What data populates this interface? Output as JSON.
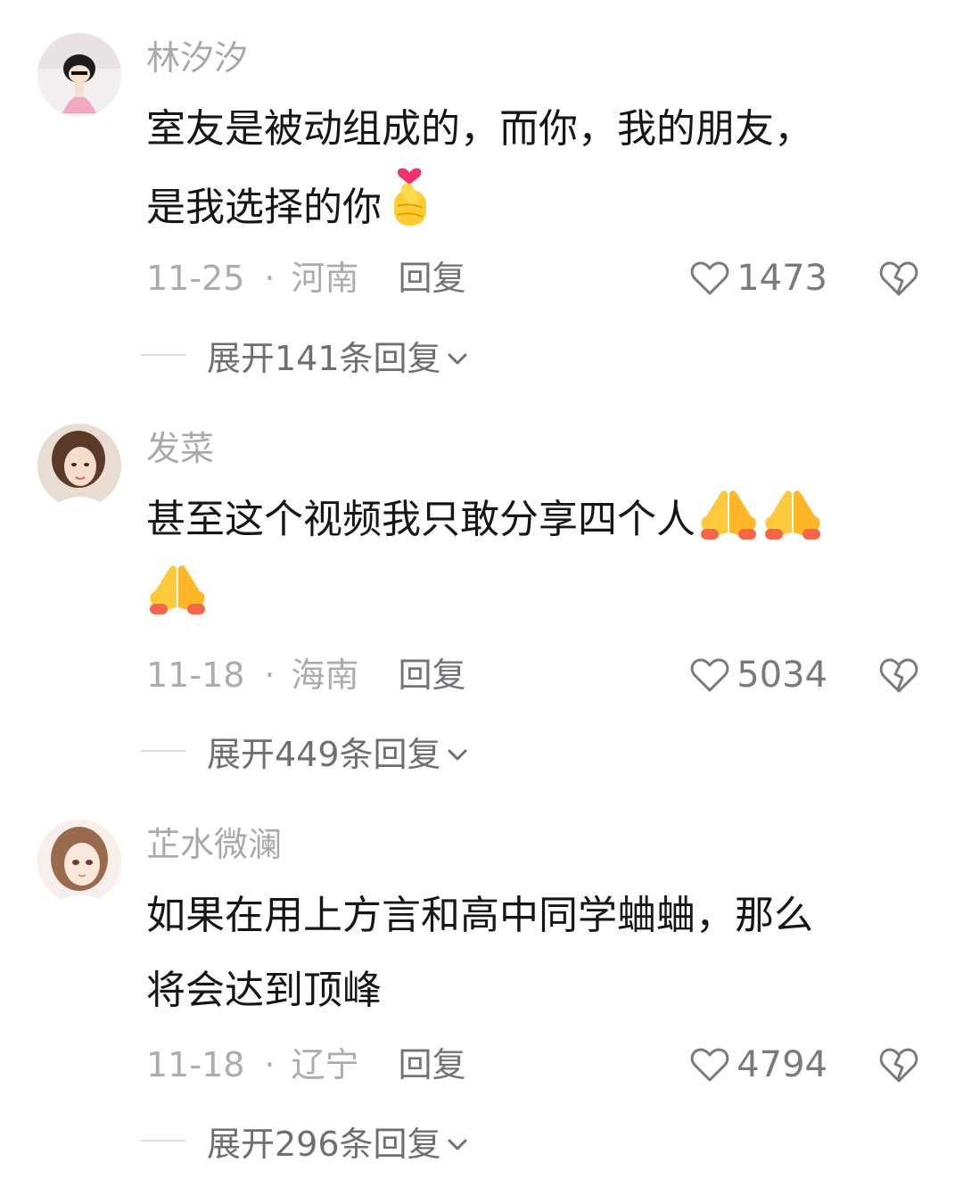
{
  "comments": [
    {
      "username": "林汐汐",
      "text_lines": [
        "室友是被动组成的，而你，我的朋友，",
        "是我选择的你"
      ],
      "emoji": "finger-heart-emoji",
      "date": "11-25",
      "separator": "·",
      "location": "河南",
      "reply_label": "回复",
      "likes": "1473",
      "expand_label": "展开141条回复"
    },
    {
      "username": "发菜",
      "text_lines": [
        "甚至这个视频我只敢分享四个人",
        ""
      ],
      "emoji": "folded-hands-emoji",
      "date": "11-18",
      "separator": "·",
      "location": "海南",
      "reply_label": "回复",
      "likes": "5034",
      "expand_label": "展开449条回复"
    },
    {
      "username": "芷水微澜",
      "text_lines": [
        "如果在用上方言和高中同学蛐蛐，那么",
        "将会达到顶峰"
      ],
      "date": "11-18",
      "separator": "·",
      "location": "辽宁",
      "reply_label": "回复",
      "likes": "4794",
      "expand_label": "展开296条回复"
    }
  ],
  "colors": {
    "username": "#a9a9ad",
    "text": "#161616",
    "meta": "#acacb0",
    "reply": "#747478"
  },
  "icons": {
    "like": "heart-outline-icon",
    "dislike": "broken-heart-icon",
    "expand": "chevron-down-icon"
  }
}
